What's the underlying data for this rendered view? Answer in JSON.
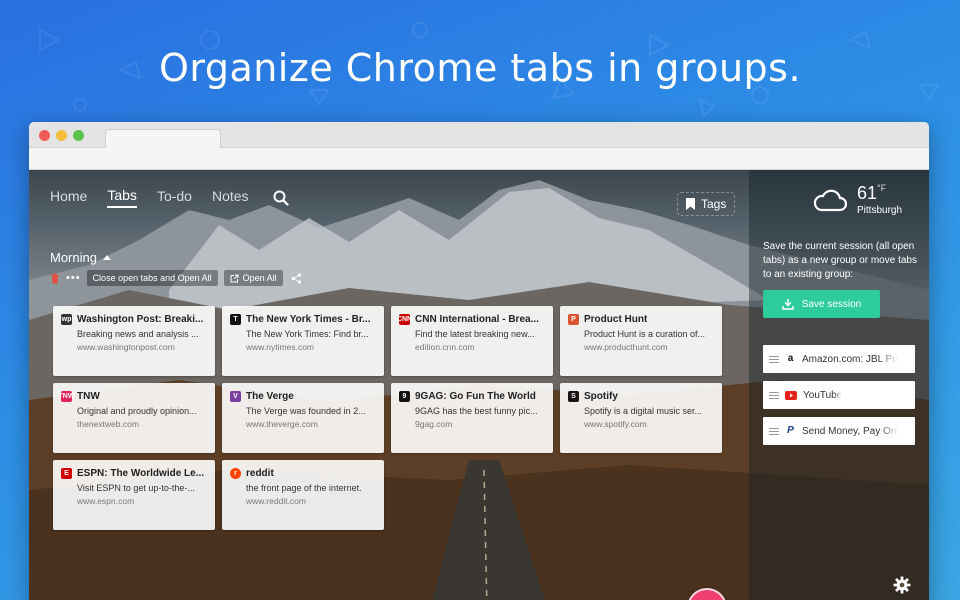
{
  "headline": "Organize Chrome tabs in groups.",
  "nav": {
    "items": [
      {
        "label": "Home",
        "active": false
      },
      {
        "label": "Tabs",
        "active": true
      },
      {
        "label": "To-do",
        "active": false
      },
      {
        "label": "Notes",
        "active": false
      }
    ],
    "search_icon": "search-icon"
  },
  "tags": {
    "label": "Tags",
    "icon": "bookmark-icon"
  },
  "group": {
    "title": "Morning",
    "close_open_label": "Close open tabs and Open All",
    "open_all_label": "Open All"
  },
  "cards": [
    {
      "title": "Washington Post: Breaki...",
      "desc": "Breaking news and analysis ...",
      "url": "www.washingtonpost.com",
      "fav": "wp",
      "fav_color": "#333333"
    },
    {
      "title": "The New York Times - Br...",
      "desc": "The New York Times: Find br...",
      "url": "www.nytimes.com",
      "fav": "T",
      "fav_color": "#111111"
    },
    {
      "title": "CNN International - Brea...",
      "desc": "Find the latest breaking new...",
      "url": "edition.cnn.com",
      "fav": "CNN",
      "fav_color": "#cc0000"
    },
    {
      "title": "Product Hunt",
      "desc": "Product Hunt is a curation of...",
      "url": "www.producthunt.com",
      "fav": "P",
      "fav_color": "#da552f"
    },
    {
      "title": "TNW",
      "desc": "Original and proudly opinion...",
      "url": "thenextweb.com",
      "fav": "TNW",
      "fav_color": "#e0215a"
    },
    {
      "title": "The Verge",
      "desc": "The Verge was founded in 2...",
      "url": "www.theverge.com",
      "fav": "V",
      "fav_color": "#7b3fa0"
    },
    {
      "title": "9GAG: Go Fun The World",
      "desc": "9GAG has the best funny pic...",
      "url": "9gag.com",
      "fav": "9",
      "fav_color": "#111111"
    },
    {
      "title": "Spotify",
      "desc": "Spotify is a digital music ser...",
      "url": "www.spotify.com",
      "fav": "S",
      "fav_color": "#191414"
    },
    {
      "title": "ESPN: The Worldwide Le...",
      "desc": "Visit ESPN to get up-to-the-...",
      "url": "www.espn.com",
      "fav": "E",
      "fav_color": "#d00000"
    },
    {
      "title": "reddit",
      "desc": "the front page of the internet.",
      "url": "www.reddit.com",
      "fav": "r",
      "fav_color": "#ff4500"
    }
  ],
  "weather": {
    "temp": "61",
    "unit": "°F",
    "city": "Pittsburgh",
    "icon": "cloud-icon"
  },
  "sidebar": {
    "save_text": "Save the current session (all open tabs) as a new group or move tabs to an existing group:",
    "save_button": "Save session",
    "saved_groups": [
      {
        "label": "Amazon.com: JBL Pu",
        "icon": "amazon-icon"
      },
      {
        "label": "YouTube",
        "icon": "youtube-icon"
      },
      {
        "label": "Send Money, Pay Onl",
        "icon": "paypal-icon"
      }
    ]
  },
  "colors": {
    "accent_green": "#2ecc9b",
    "fab_pink": "#ee3f6f"
  }
}
